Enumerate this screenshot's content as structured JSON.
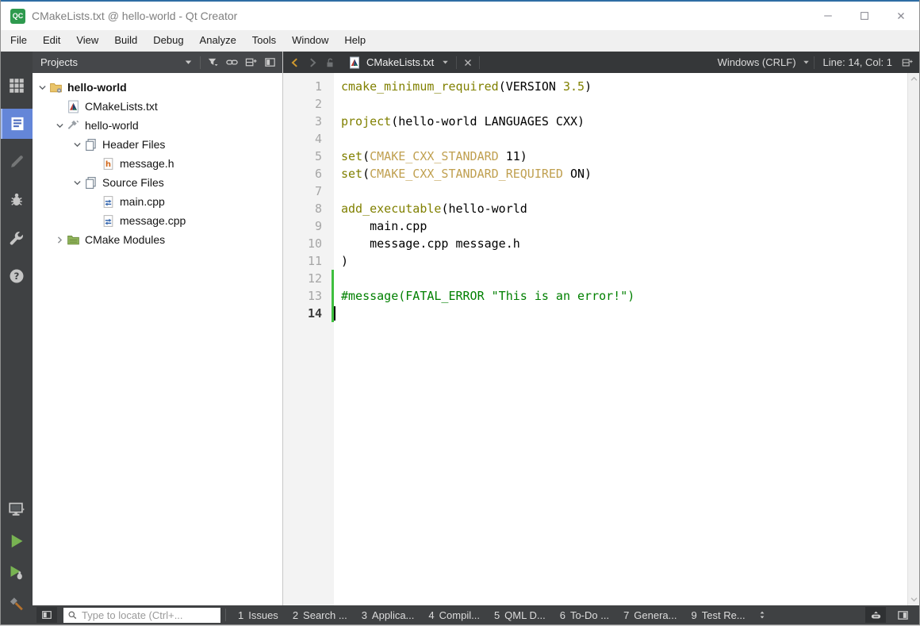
{
  "window": {
    "title": "CMakeLists.txt @ hello-world - Qt Creator",
    "logo_text": "QC"
  },
  "menu": {
    "items": [
      "File",
      "Edit",
      "View",
      "Build",
      "Debug",
      "Analyze",
      "Tools",
      "Window",
      "Help"
    ]
  },
  "mode_selector": {
    "top": [
      {
        "name": "welcome",
        "icon": "grid-icon",
        "selected": false,
        "disabled": false
      },
      {
        "name": "edit",
        "icon": "edit-document-icon",
        "selected": true,
        "disabled": false
      },
      {
        "name": "design",
        "icon": "pencil-icon",
        "selected": false,
        "disabled": true
      },
      {
        "name": "debug",
        "icon": "bug-icon",
        "selected": false,
        "disabled": false
      },
      {
        "name": "projects",
        "icon": "wrench-icon",
        "selected": false,
        "disabled": false
      },
      {
        "name": "help",
        "icon": "help-icon",
        "selected": false,
        "disabled": false
      }
    ],
    "bottom": [
      {
        "name": "kit-selector",
        "icon": "monitor-icon"
      },
      {
        "name": "run",
        "icon": "run-play-icon"
      },
      {
        "name": "debug-run",
        "icon": "debug-run-icon"
      },
      {
        "name": "build",
        "icon": "hammer-icon"
      }
    ]
  },
  "projects_panel": {
    "title": "Projects",
    "toolbar_icons": [
      "dropdown-icon",
      "filter-icon",
      "link-icon",
      "split-icon",
      "collapse-panel-icon"
    ],
    "tree": [
      {
        "label": "hello-world",
        "icon": "project-folder-icon",
        "chevron": "down",
        "indent": 0,
        "bold": true
      },
      {
        "label": "CMakeLists.txt",
        "icon": "cmake-file-icon",
        "chevron": "none",
        "indent": 1,
        "bold": false
      },
      {
        "label": "hello-world",
        "icon": "build-target-icon",
        "chevron": "down",
        "indent": 1,
        "bold": false
      },
      {
        "label": "Header Files",
        "icon": "file-group-icon",
        "chevron": "down",
        "indent": 2,
        "bold": false
      },
      {
        "label": "message.h",
        "icon": "header-file-icon",
        "chevron": "none",
        "indent": 3,
        "bold": false
      },
      {
        "label": "Source Files",
        "icon": "file-group-icon",
        "chevron": "down",
        "indent": 2,
        "bold": false
      },
      {
        "label": "main.cpp",
        "icon": "cpp-file-icon",
        "chevron": "none",
        "indent": 3,
        "bold": false
      },
      {
        "label": "message.cpp",
        "icon": "cpp-file-icon",
        "chevron": "none",
        "indent": 3,
        "bold": false
      },
      {
        "label": "CMake Modules",
        "icon": "modules-folder-icon",
        "chevron": "right",
        "indent": 1,
        "bold": false
      }
    ]
  },
  "editor": {
    "tab": {
      "label": "CMakeLists.txt"
    },
    "line_ending": "Windows (CRLF)",
    "cursor_position": "Line: 14, Col: 1",
    "current_line": 14,
    "changed_lines": [
      12,
      13,
      14
    ],
    "syntax_colors": {
      "command": "#808000",
      "variable": "#c0a050",
      "number": "#808000",
      "comment": "#008000",
      "plain": "#000000"
    },
    "lines": [
      {
        "n": 1,
        "segs": [
          {
            "t": "cmake_minimum_required",
            "c": "command"
          },
          {
            "t": "(VERSION ",
            "c": "plain"
          },
          {
            "t": "3.5",
            "c": "number"
          },
          {
            "t": ")",
            "c": "plain"
          }
        ]
      },
      {
        "n": 2,
        "segs": []
      },
      {
        "n": 3,
        "segs": [
          {
            "t": "project",
            "c": "command"
          },
          {
            "t": "(hello-world LANGUAGES CXX)",
            "c": "plain"
          }
        ]
      },
      {
        "n": 4,
        "segs": []
      },
      {
        "n": 5,
        "segs": [
          {
            "t": "set",
            "c": "command"
          },
          {
            "t": "(",
            "c": "plain"
          },
          {
            "t": "CMAKE_CXX_STANDARD",
            "c": "variable"
          },
          {
            "t": " 11)",
            "c": "plain"
          }
        ]
      },
      {
        "n": 6,
        "segs": [
          {
            "t": "set",
            "c": "command"
          },
          {
            "t": "(",
            "c": "plain"
          },
          {
            "t": "CMAKE_CXX_STANDARD_REQUIRED",
            "c": "variable"
          },
          {
            "t": " ON)",
            "c": "plain"
          }
        ]
      },
      {
        "n": 7,
        "segs": []
      },
      {
        "n": 8,
        "segs": [
          {
            "t": "add_executable",
            "c": "command"
          },
          {
            "t": "(hello-world",
            "c": "plain"
          }
        ]
      },
      {
        "n": 9,
        "segs": [
          {
            "t": "    main.cpp",
            "c": "plain"
          }
        ]
      },
      {
        "n": 10,
        "segs": [
          {
            "t": "    message.cpp message.h",
            "c": "plain"
          }
        ]
      },
      {
        "n": 11,
        "segs": [
          {
            "t": ")",
            "c": "plain"
          }
        ]
      },
      {
        "n": 12,
        "segs": []
      },
      {
        "n": 13,
        "segs": [
          {
            "t": "#message(FATAL_ERROR \"This is an error!\")",
            "c": "comment"
          }
        ]
      },
      {
        "n": 14,
        "segs": []
      }
    ]
  },
  "statusbar": {
    "locator_placeholder": "Type to locate (Ctrl+...",
    "panes": [
      {
        "key": "1",
        "label": "Issues"
      },
      {
        "key": "2",
        "label": "Search ..."
      },
      {
        "key": "3",
        "label": "Applica..."
      },
      {
        "key": "4",
        "label": "Compil..."
      },
      {
        "key": "5",
        "label": "QML D..."
      },
      {
        "key": "6",
        "label": "To-Do ..."
      },
      {
        "key": "7",
        "label": "Genera..."
      },
      {
        "key": "9",
        "label": "Test Re..."
      }
    ]
  },
  "colors": {
    "accent_blue": "#2e6da4",
    "sidebar_bg": "#3f4143",
    "panel_header_bg": "#45474a",
    "tabbar_bg": "#353739",
    "selected_mode_bg": "#6486d8",
    "changebar_green": "#3fbf3f",
    "gold_arrow": "#d19a2f"
  }
}
